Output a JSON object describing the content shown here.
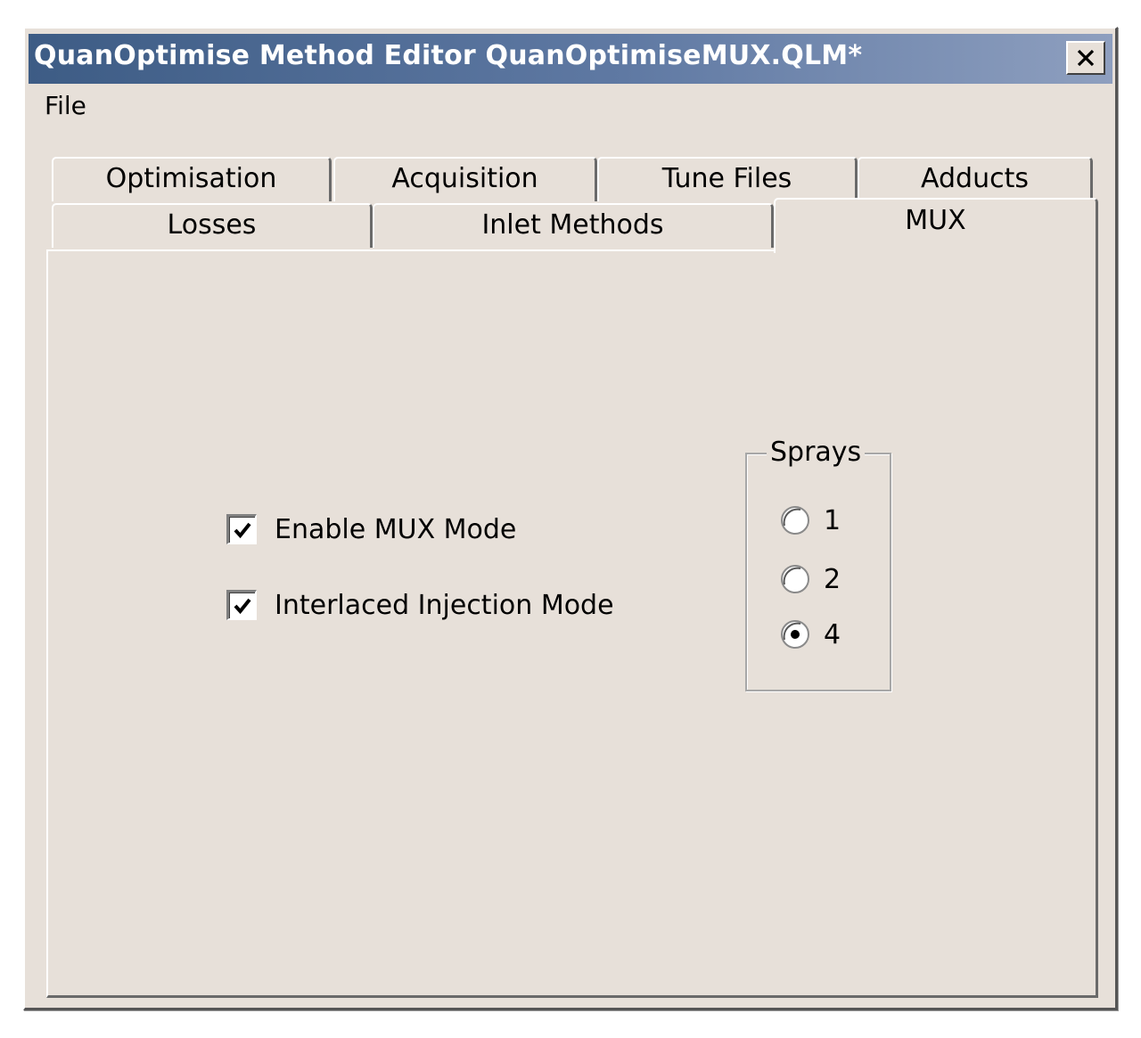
{
  "window": {
    "title": "QuanOptimise Method Editor QuanOptimiseMUX.QLM*",
    "close_icon": "close-icon"
  },
  "menu": {
    "items": [
      {
        "label": "File"
      }
    ]
  },
  "tabs": {
    "row1": [
      {
        "label": "Optimisation"
      },
      {
        "label": "Acquisition"
      },
      {
        "label": "Tune Files"
      },
      {
        "label": "Adducts"
      }
    ],
    "row2": [
      {
        "label": "Losses"
      },
      {
        "label": "Inlet Methods"
      },
      {
        "label": "MUX",
        "active": true
      }
    ]
  },
  "mux": {
    "enable_mux_mode": {
      "label": "Enable MUX Mode",
      "checked": true
    },
    "interlaced_injection_mode": {
      "label": "Interlaced Injection Mode",
      "checked": true
    },
    "sprays": {
      "legend": "Sprays",
      "options": [
        {
          "label": "1",
          "selected": false
        },
        {
          "label": "2",
          "selected": false
        },
        {
          "label": "4",
          "selected": true
        }
      ]
    }
  },
  "colors": {
    "face": "#e7e0d9",
    "title_start": "#3d5c85",
    "title_end": "#8e9fbf",
    "text": "#000000"
  }
}
